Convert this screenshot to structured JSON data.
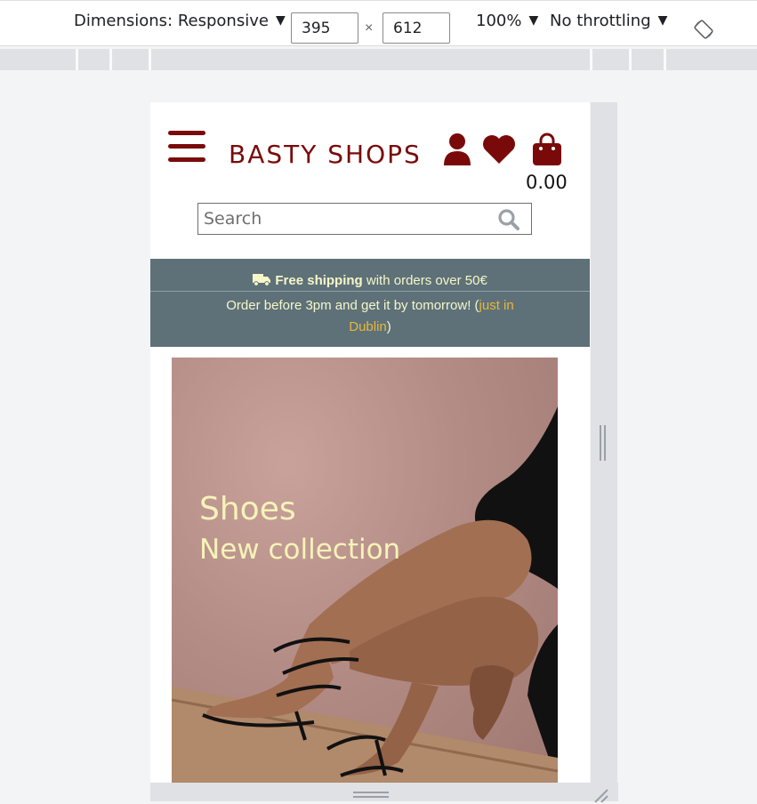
{
  "devtools": {
    "dimensions_label": "Dimensions: Responsive",
    "width": "395",
    "height": "612",
    "times": "×",
    "zoom": "100%",
    "throttling": "No throttling"
  },
  "site": {
    "brand": "BASTY SHOPS",
    "cart_total": "0.00",
    "search_placeholder": "Search",
    "banner": {
      "shipping_bold": "Free shipping",
      "shipping_rest": " with orders over 50€",
      "order_text": "Order before 3pm and get it by tomorrow! (",
      "order_accent": "just in Dublin",
      "order_close": ")"
    },
    "hero": {
      "title": "Shoes",
      "subtitle": "New collection"
    }
  },
  "colors": {
    "brand": "#7a0a0a",
    "banner_bg": "#5e7179",
    "banner_text": "#f5f7c8",
    "accent": "#e8b838",
    "hero_text": "#f6f3b8"
  }
}
